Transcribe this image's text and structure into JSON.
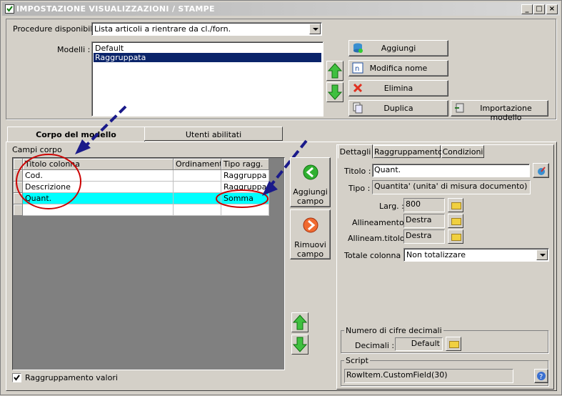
{
  "window": {
    "title": "IMPOSTAZIONE VISUALIZZAZIONI / STAMPE"
  },
  "top": {
    "procedure_label": "Procedure disponibili :",
    "procedure_value": "Lista articoli a rientrare da cl./forn.",
    "models_label": "Modelli :",
    "models": [
      "Default",
      "Raggruppata"
    ],
    "buttons": {
      "add": "Aggiungi",
      "rename": "Modifica nome",
      "delete": "Elimina",
      "duplicate": "Duplica",
      "import": "Importazione modello"
    }
  },
  "tabs": {
    "body": "Corpo del modello",
    "users": "Utenti abilitati"
  },
  "body": {
    "fields_label": "Campi corpo",
    "columns": [
      "Titolo colonna",
      "Ordinamento",
      "Tipo ragg."
    ],
    "rows": [
      {
        "title": "Cod.",
        "order": "",
        "type": "Raggruppa"
      },
      {
        "title": "Descrizione",
        "order": "",
        "type": "Raggruppa"
      },
      {
        "title": "Quant.",
        "order": "",
        "type": "Somma"
      },
      {
        "title": "",
        "order": "",
        "type": ""
      }
    ],
    "add_field": "Aggiungi campo",
    "remove_field": "Rimuovi campo",
    "group_values": "Raggruppamento valori"
  },
  "details": {
    "tabs": [
      "Dettagli",
      "Raggruppamento",
      "Condizioni"
    ],
    "title_label": "Titolo :",
    "title_value": "Quant.",
    "type_label": "Tipo :",
    "type_value": "Quantita' (unita' di misura documento)",
    "width_label": "Larg. :",
    "width_value": "800",
    "align_label": "Allineamento :",
    "align_value": "Destra",
    "title_align_label": "Allineam.titolo :",
    "title_align_value": "Destra",
    "total_label": "Totale colonna :",
    "total_value": "Non totalizzare",
    "decimals_group": "Numero di cifre decimali",
    "decimals_label": "Decimali :",
    "decimals_value": "Default",
    "script_group": "Script",
    "script_value": "RowItem.CustomField(30)"
  },
  "colors": {
    "selection": "#0a246a",
    "highlight_row": "#00ffff",
    "annotation": "#cc0000",
    "arrow": "#1a1a8a"
  }
}
